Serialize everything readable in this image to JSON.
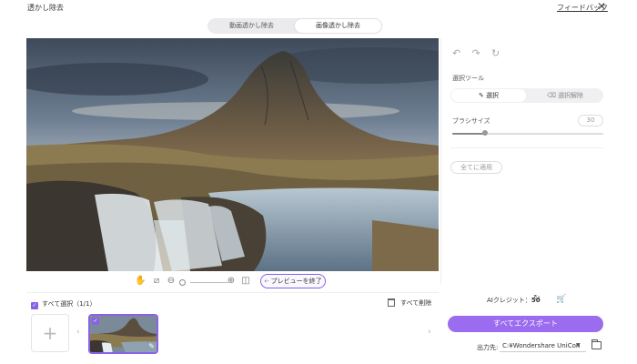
{
  "window": {
    "title": "透かし除去",
    "feedback_link": "フィードバック",
    "close_icon": "✕"
  },
  "mode_tabs": [
    {
      "label": "動画透かし除去",
      "active": false
    },
    {
      "label": "画像透かし除去",
      "active": true
    }
  ],
  "preview_toolbar": {
    "end_preview_label": "プレビューを終了",
    "end_preview_icon": "‹·"
  },
  "right_panel": {
    "undo_icons": [
      "↶",
      "↷",
      "↻"
    ],
    "select_tool_label": "選択ツール",
    "tool_select": "選択",
    "tool_deselect": "選択解除",
    "brush_size_label": "ブラシサイズ",
    "brush_size_value": "30",
    "apply_all_label": "全てに適用"
  },
  "files": {
    "select_all_label": "すべて選択（1/1）",
    "delete_all_label": "すべて削除",
    "add_symbol": "+",
    "arrow_left": "‹",
    "arrow_right": "›",
    "thumb_check": "✓",
    "thumb_edit": "✎"
  },
  "export": {
    "credit_label": "AIクレジット：",
    "credit_value": "50",
    "export_all_label": "すべてエクスポート",
    "output_label": "出力先:",
    "output_path": "C:¥Wondershare UniCon"
  },
  "colors": {
    "accent": "#8a62e8",
    "export_button": "#9b6bf0"
  }
}
